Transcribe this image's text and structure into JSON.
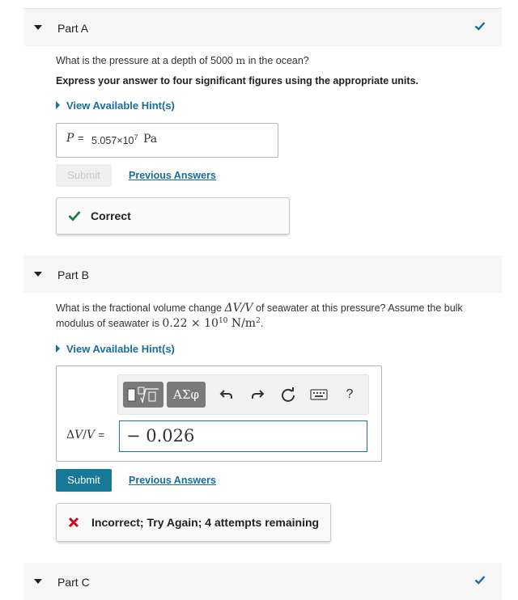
{
  "partA": {
    "title": "Part A",
    "question_pre": "What is the pressure at a depth of 5000 ",
    "question_unit": "m",
    "question_post": " in the ocean?",
    "instruction": "Express your answer to four significant figures using the appropriate units.",
    "hint": "View Available Hint(s)",
    "answer_label": "P",
    "answer_eq": "=",
    "answer_mantissa": "5.057×10",
    "answer_exp": "7",
    "answer_unit": "Pa",
    "submit": "Submit",
    "previous": "Previous Answers",
    "feedback": "Correct",
    "status_color": "#1c7c3c"
  },
  "partB": {
    "title": "Part B",
    "question_line1_pre": "What is the fractional volume change ",
    "question_line1_math": "ΔV/V",
    "question_line1_post": " of seawater at this pressure? Assume the bulk",
    "question_line2_pre": "modulus of seawater is ",
    "question_line2_math": "0.22 × 10",
    "question_line2_exp": "10",
    "question_line2_unit": "N/m",
    "question_line2_unit_exp": "2",
    "question_line2_post": ".",
    "hint": "View Available Hint(s)",
    "toolbar": {
      "greek": "ΑΣφ",
      "help": "?"
    },
    "answer_label_delta": "Δ",
    "answer_label_v": "V",
    "answer_label_slash": "/",
    "answer_label_v2": "V",
    "answer_eq": "=",
    "answer_value": "− 0.026",
    "submit": "Submit",
    "previous": "Previous Answers",
    "feedback": "Incorrect; Try Again; 4 attempts remaining",
    "error_color": "#d0021b"
  },
  "partC": {
    "title": "Part C"
  },
  "icons": {
    "check": "checkmark-icon",
    "cross": "x-icon",
    "caret": "caret-down-icon"
  },
  "colors": {
    "accent": "#177897",
    "link": "#176e9c",
    "check": "#176e9c"
  }
}
